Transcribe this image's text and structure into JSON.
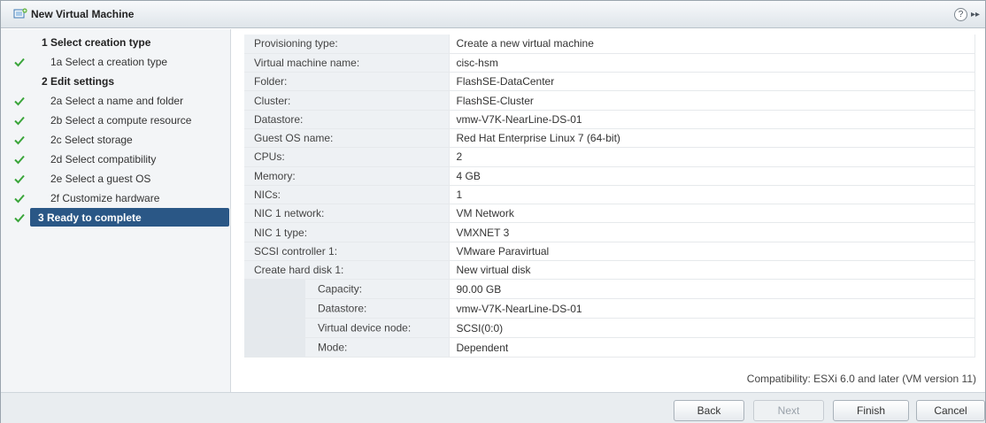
{
  "window": {
    "title": "New Virtual Machine",
    "help_icon": "help-icon",
    "help_glyph": "?",
    "expand_glyph": "▸▸"
  },
  "steps": [
    {
      "label": "1  Select creation type",
      "type": "head",
      "checked": false
    },
    {
      "label": "1a  Select a creation type",
      "type": "sub",
      "checked": true
    },
    {
      "label": "2  Edit settings",
      "type": "head",
      "checked": false
    },
    {
      "label": "2a  Select a name and folder",
      "type": "sub",
      "checked": true
    },
    {
      "label": "2b  Select a compute resource",
      "type": "sub",
      "checked": true
    },
    {
      "label": "2c  Select storage",
      "type": "sub",
      "checked": true
    },
    {
      "label": "2d  Select compatibility",
      "type": "sub",
      "checked": true
    },
    {
      "label": "2e  Select a guest OS",
      "type": "sub",
      "checked": true
    },
    {
      "label": "2f  Customize hardware",
      "type": "sub",
      "checked": true
    },
    {
      "label": "3  Ready to complete",
      "type": "active",
      "checked": true
    }
  ],
  "summary": [
    {
      "key": "Provisioning type:",
      "value": "Create a new virtual machine"
    },
    {
      "key": "Virtual machine name:",
      "value": "cisc-hsm"
    },
    {
      "key": "Folder:",
      "value": "FlashSE-DataCenter"
    },
    {
      "key": "Cluster:",
      "value": "FlashSE-Cluster"
    },
    {
      "key": "Datastore:",
      "value": "vmw-V7K-NearLine-DS-01"
    },
    {
      "key": "Guest OS name:",
      "value": "Red Hat Enterprise Linux 7 (64-bit)"
    },
    {
      "key": "CPUs:",
      "value": "2"
    },
    {
      "key": "Memory:",
      "value": "4 GB"
    },
    {
      "key": "NICs:",
      "value": "1"
    },
    {
      "key": "NIC 1 network:",
      "value": "VM Network"
    },
    {
      "key": "NIC 1 type:",
      "value": "VMXNET 3"
    },
    {
      "key": "SCSI controller 1:",
      "value": "VMware Paravirtual"
    },
    {
      "key": "Create hard disk 1:",
      "value": "New virtual disk"
    },
    {
      "key": "Capacity:",
      "value": "90.00 GB",
      "nested": true
    },
    {
      "key": "Datastore:",
      "value": "vmw-V7K-NearLine-DS-01",
      "nested": true
    },
    {
      "key": "Virtual device node:",
      "value": "SCSI(0:0)",
      "nested": true
    },
    {
      "key": "Mode:",
      "value": "Dependent",
      "nested": true
    }
  ],
  "compatibility": "Compatibility: ESXi 6.0 and later (VM version 11)",
  "buttons": {
    "back": "Back",
    "next": "Next",
    "finish": "Finish",
    "cancel": "Cancel"
  },
  "colors": {
    "active_step": "#2a5786",
    "check": "#3aa53a"
  }
}
